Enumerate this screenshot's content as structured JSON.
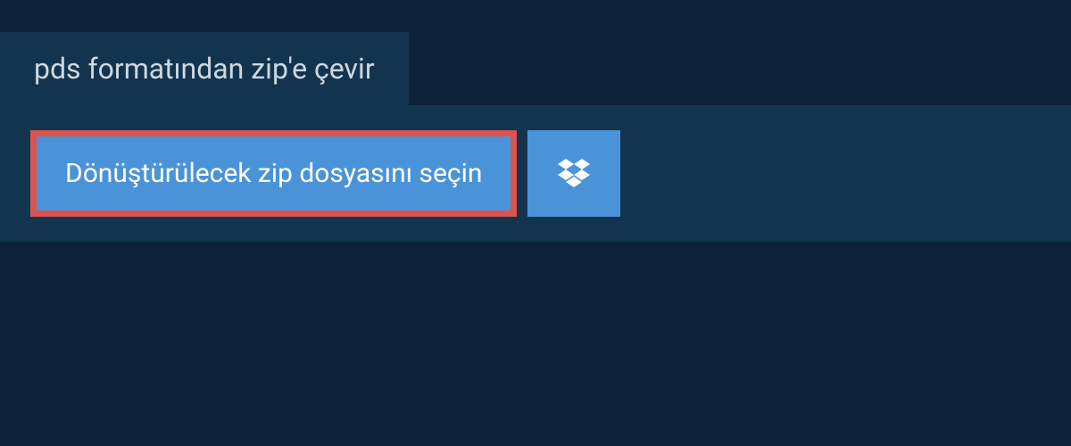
{
  "tab": {
    "label": "pds formatından zip'e çevir"
  },
  "panel": {
    "select_button_label": "Dönüştürülecek zip dosyasını seçin"
  }
}
